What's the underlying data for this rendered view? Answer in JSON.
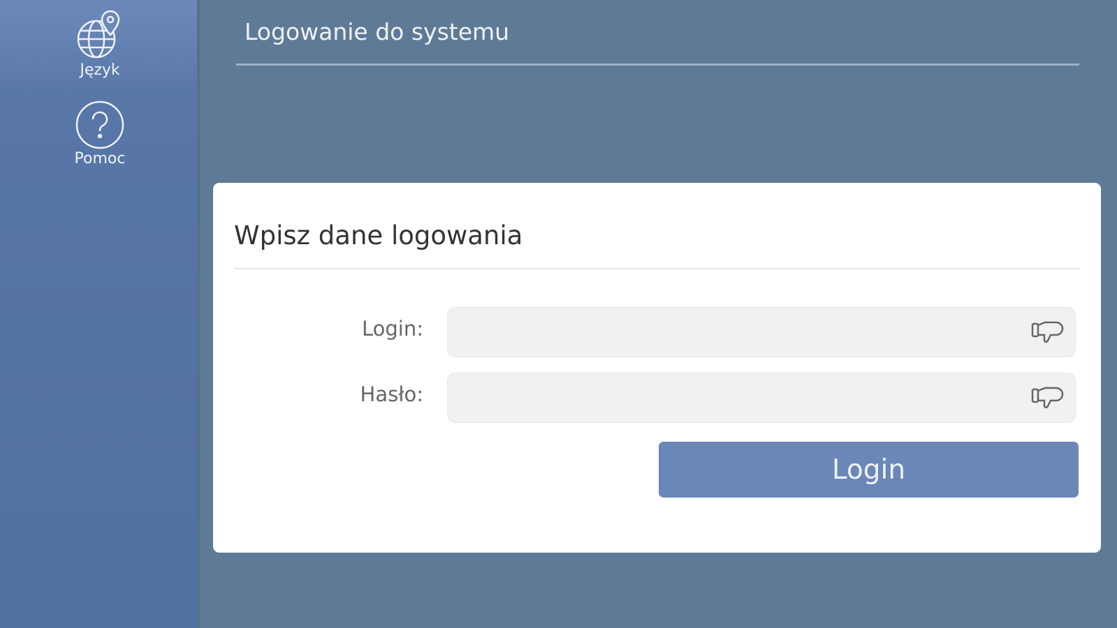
{
  "sidebar": {
    "items": [
      {
        "label": "Język",
        "icon": "globe-location-icon"
      },
      {
        "label": "Pomoc",
        "icon": "help-circle-icon"
      }
    ]
  },
  "header": {
    "title": "Logowanie do systemu"
  },
  "form": {
    "title": "Wpisz dane logowania",
    "login_label": "Login:",
    "login_value": "",
    "password_label": "Hasło:",
    "password_value": "",
    "submit_label": "Login"
  }
}
